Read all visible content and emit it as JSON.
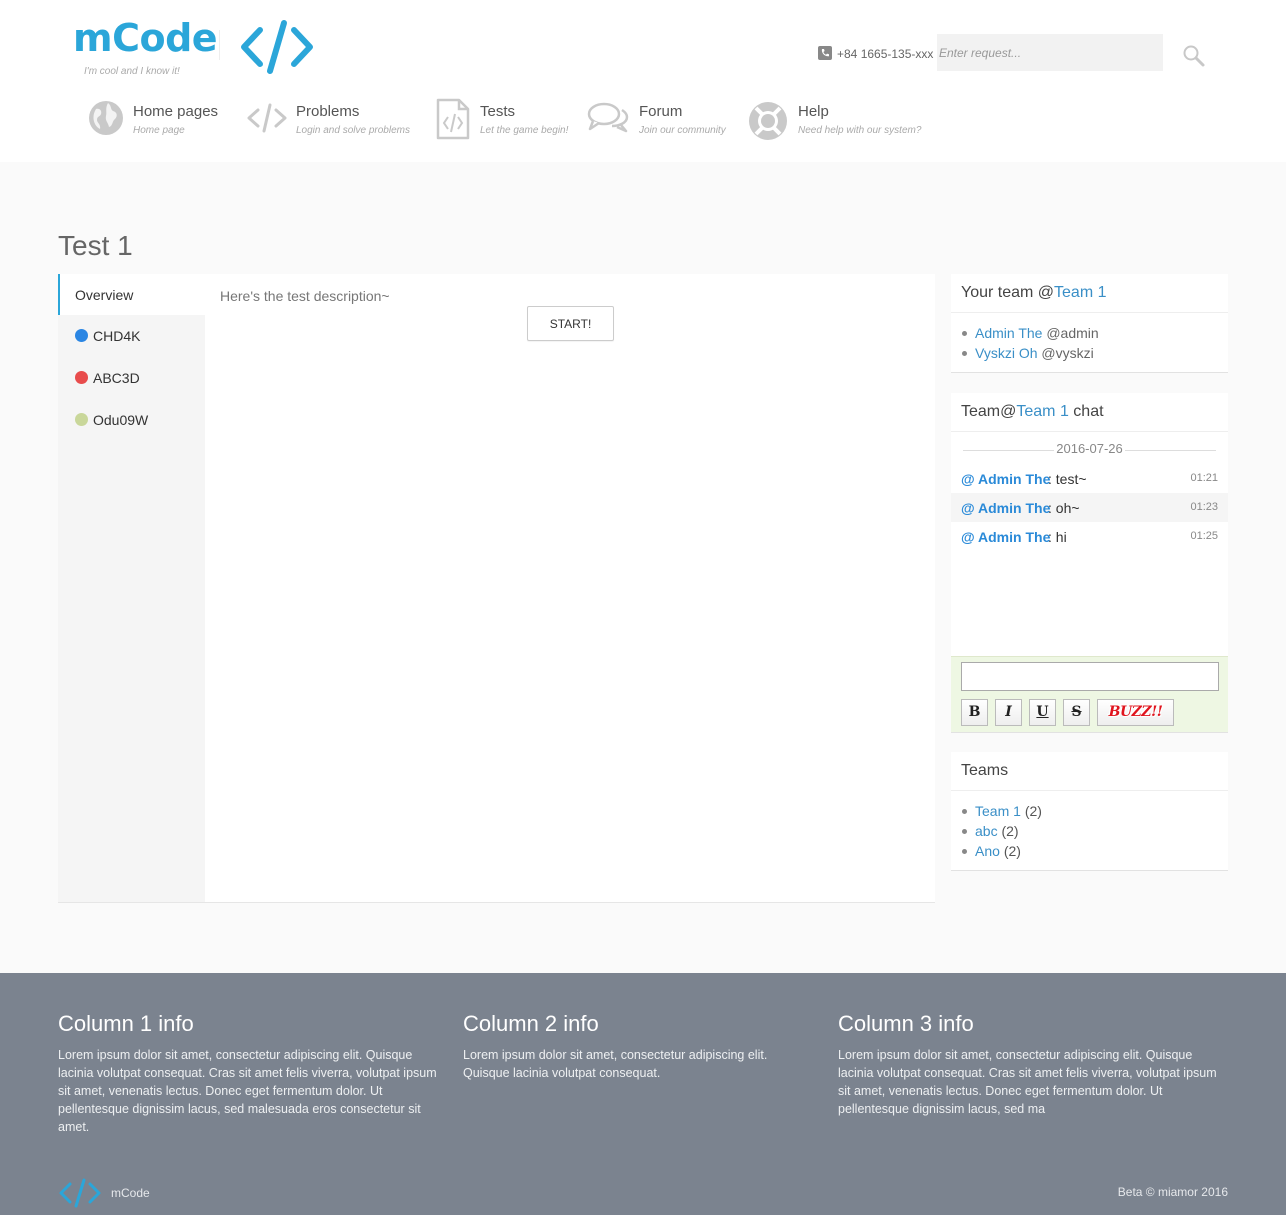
{
  "header": {
    "logo_text": "mCode",
    "tagline": "I'm cool and I know it!",
    "phone": "+84 1665-135-xxx",
    "search_placeholder": "Enter request...",
    "accent_color": "#2ba6d9"
  },
  "nav": [
    {
      "title": "Home pages",
      "subtitle": "Home page",
      "icon": "globe-icon"
    },
    {
      "title": "Problems",
      "subtitle": "Login and solve problems",
      "icon": "code-icon"
    },
    {
      "title": "Tests",
      "subtitle": "Let the game begin!",
      "icon": "file-code-icon"
    },
    {
      "title": "Forum",
      "subtitle": "Join our community",
      "icon": "chat-bubbles-icon"
    },
    {
      "title": "Help",
      "subtitle": "Need help with our system?",
      "icon": "lifebuoy-icon"
    }
  ],
  "main": {
    "title": "Test 1",
    "tabs": [
      {
        "label": "Overview"
      },
      {
        "label": "CHD4K",
        "color": "#2b86e3"
      },
      {
        "label": "ABC3D",
        "color": "#e84c4c"
      },
      {
        "label": "Odu09W",
        "color": "#c9d79a"
      }
    ],
    "description": "Here's the test description~",
    "start_label": "START!"
  },
  "team_panel": {
    "title_prefix": "Your team @",
    "team_name": "Team 1",
    "members": [
      {
        "name": "Admin The",
        "handle": "@admin"
      },
      {
        "name": "Vyskzi Oh",
        "handle": "@vyskzi"
      }
    ]
  },
  "chat_panel": {
    "title_prefix": "Team@",
    "team_name": "Team 1",
    "title_suffix": " chat",
    "date": "2016-07-26",
    "messages": [
      {
        "author": "@ Admin The",
        "text": ": test~",
        "time": "01:21"
      },
      {
        "author": "@ Admin The",
        "text": ": oh~",
        "time": "01:23"
      },
      {
        "author": "@ Admin The",
        "text": ": hi",
        "time": "01:25"
      }
    ],
    "buttons": {
      "bold": "B",
      "italic": "I",
      "underline": "U",
      "strike": "S",
      "buzz": "BUZZ!!"
    }
  },
  "teams_panel": {
    "title": "Teams",
    "teams": [
      {
        "name": "Team 1",
        "count": "(2)"
      },
      {
        "name": "abc",
        "count": "(2)"
      },
      {
        "name": "Ano",
        "count": "(2)"
      }
    ]
  },
  "footer": {
    "columns": [
      {
        "title": "Column 1 info",
        "text": "Lorem ipsum dolor sit amet, consectetur adipiscing elit. Quisque lacinia volutpat consequat. Cras sit amet felis viverra, volutpat ipsum sit amet, venenatis lectus. Donec eget fermentum dolor. Ut pellentesque dignissim lacus, sed malesuada eros consectetur sit amet."
      },
      {
        "title": "Column 2 info",
        "text": "Lorem ipsum dolor sit amet, consectetur adipiscing elit. Quisque lacinia volutpat consequat."
      },
      {
        "title": "Column 3 info",
        "text": "Lorem ipsum dolor sit amet, consectetur adipiscing elit. Quisque lacinia volutpat consequat. Cras sit amet felis viverra, volutpat ipsum sit amet, venenatis lectus. Donec eget fermentum dolor. Ut pellentesque dignissim lacus, sed ma"
      }
    ],
    "brand": "mCode",
    "copyright": "Beta © miamor 2016"
  }
}
